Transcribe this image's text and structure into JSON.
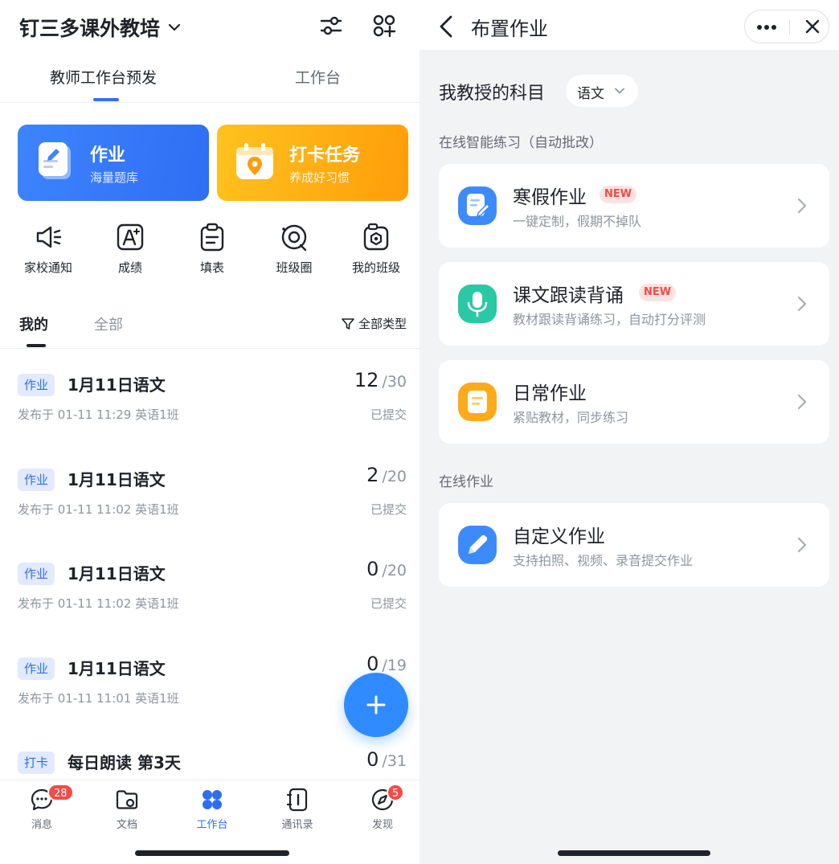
{
  "left": {
    "org_name": "钉三多课外教培",
    "top_tabs": [
      {
        "label": "教师工作台预发",
        "active": true
      },
      {
        "label": "工作台",
        "active": false
      }
    ],
    "cards": [
      {
        "title": "作业",
        "subtitle": "海量题库",
        "icon": "homework-note-icon"
      },
      {
        "title": "打卡任务",
        "subtitle": "养成好习惯",
        "icon": "checkin-calendar-icon"
      }
    ],
    "quick_actions": [
      {
        "label": "家校通知",
        "icon": "megaphone-icon"
      },
      {
        "label": "成绩",
        "icon": "grade-a-icon"
      },
      {
        "label": "填表",
        "icon": "clipboard-form-icon"
      },
      {
        "label": "班级圈",
        "icon": "class-circle-icon"
      },
      {
        "label": "我的班级",
        "icon": "my-class-icon"
      }
    ],
    "filter_tabs": [
      {
        "label": "我的",
        "active": true
      },
      {
        "label": "全部",
        "active": false
      }
    ],
    "type_filter": "全部类型",
    "assignments": [
      {
        "tag": "作业",
        "title": "1月11日语文",
        "meta": "发布于 01-11 11:29 英语1班",
        "submitted": "12",
        "total": "/30",
        "status": "已提交"
      },
      {
        "tag": "作业",
        "title": "1月11日语文",
        "meta": "发布于 01-11 11:02 英语1班",
        "submitted": "2",
        "total": "/20",
        "status": "已提交"
      },
      {
        "tag": "作业",
        "title": "1月11日语文",
        "meta": "发布于 01-11 11:02 英语1班",
        "submitted": "0",
        "total": "/20",
        "status": "已提交"
      },
      {
        "tag": "作业",
        "title": "1月11日语文",
        "meta": "发布于 01-11 11:01 英语1班",
        "submitted": "0",
        "total": "/19",
        "status": ""
      },
      {
        "tag": "打卡",
        "title": "每日朗读  第3天",
        "meta": "",
        "submitted": "0",
        "total": "/31",
        "status": ""
      }
    ],
    "bottom_nav": [
      {
        "label": "消息",
        "icon": "message-icon",
        "badge": "28",
        "active": false
      },
      {
        "label": "文档",
        "icon": "docs-icon",
        "badge": "",
        "active": false
      },
      {
        "label": "工作台",
        "icon": "workbench-icon",
        "badge": "",
        "active": true
      },
      {
        "label": "通讯录",
        "icon": "contacts-icon",
        "badge": "",
        "active": false
      },
      {
        "label": "发现",
        "icon": "discover-icon",
        "badge": "5",
        "active": false
      }
    ]
  },
  "right": {
    "title": "布置作业",
    "subject_label": "我教授的科目",
    "subject_value": "语文",
    "section_smart": "在线智能练习（自动批改）",
    "smart_items": [
      {
        "title": "寒假作业",
        "subtitle": "一键定制，假期不掉队",
        "badge": "NEW",
        "icon": "winter-homework-icon"
      },
      {
        "title": "课文跟读背诵",
        "subtitle": "教材跟读背诵练习，自动打分评测",
        "badge": "NEW",
        "icon": "microphone-icon"
      },
      {
        "title": "日常作业",
        "subtitle": "紧贴教材，同步练习",
        "badge": "",
        "icon": "daily-homework-icon"
      }
    ],
    "section_online": "在线作业",
    "online_items": [
      {
        "title": "自定义作业",
        "subtitle": "支持拍照、视频、录音提交作业",
        "badge": "",
        "icon": "pencil-icon"
      }
    ]
  },
  "colors": {
    "brand_blue": "#2f6ef2",
    "accent_orange": "#ff9d0a",
    "badge_red": "#f54a45",
    "new_badge_bg": "#fde2e2",
    "teal": "#2ac8a4"
  }
}
